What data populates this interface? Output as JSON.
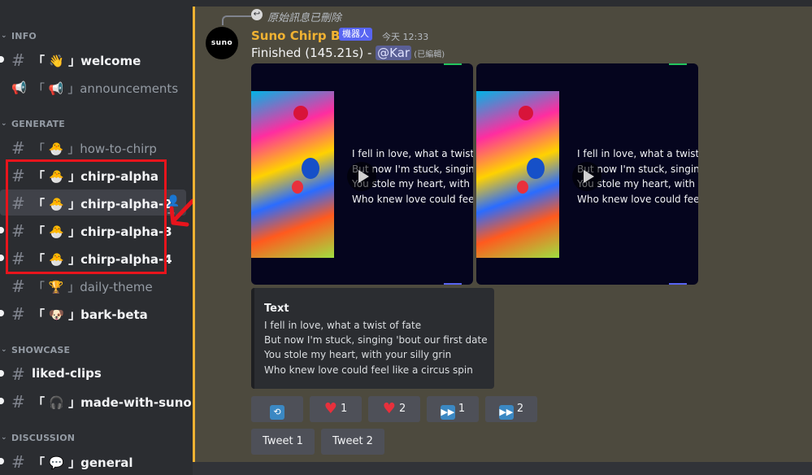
{
  "sidebar": {
    "categories": {
      "info": "INFO",
      "generate": "GENERATE",
      "showcase": "SHOWCASE",
      "discussion": "DISCUSSION"
    },
    "channels": {
      "welcome": "「 👋 」welcome",
      "announcements": "「 📢 」announcements",
      "how_to_chirp": "「 🐣 」how-to-chirp",
      "chirp_alpha": "「 🐣 」chirp-alpha",
      "chirp_alpha_2": "「 🐣 」chirp-alpha-2",
      "chirp_alpha_3": "「 🐣 」chirp-alpha-3",
      "chirp_alpha_4": "「 🐣 」chirp-alpha-4",
      "daily_theme": "「 🏆 」daily-theme",
      "bark_beta": "「 🐶 」bark-beta",
      "liked_clips": "liked-clips",
      "made_with_suno": "「 🎧 」made-with-suno",
      "general": "「 💬 」general"
    },
    "symbols": {
      "hash": "#",
      "chevron": "⌄",
      "add_user": "👤+"
    }
  },
  "message": {
    "reply_text": "原始訊息已刪除",
    "avatar_text": "suno",
    "username": "Suno Chirp Bot",
    "bot_badge": "機器人",
    "timestamp": "今天 12:33",
    "content_prefix": "Finished (145.21s) - ",
    "mention": "@Kar",
    "edited": " (已編輯)",
    "lyrics": [
      "I fell in love, what a twist of fate",
      "But now I'm stuck, singing 'bout our first date",
      "You stole my heart, with your silly grin",
      "Who knew love could feel like a circus spin"
    ],
    "embed_title": "Text"
  },
  "buttons": {
    "heart_1_count": "1",
    "heart_2_count": "2",
    "ff_1_count": "1",
    "ff_2_count": "2",
    "tweet_1": "Tweet 1",
    "tweet_2": "Tweet 2"
  },
  "colors": {
    "highlight": "#e8141c",
    "accent_bar": "#f0b232",
    "bot_badge": "#5865f2"
  }
}
